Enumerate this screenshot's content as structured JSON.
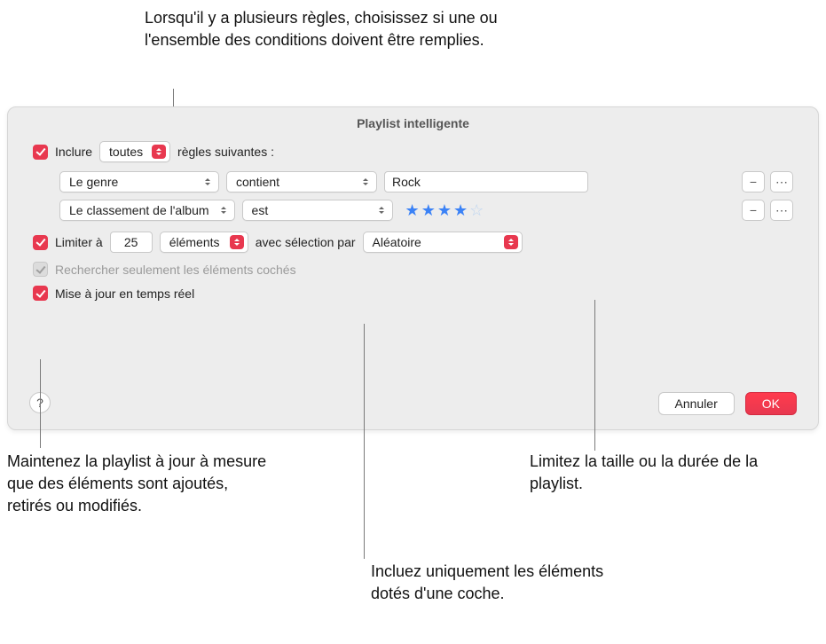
{
  "callouts": {
    "top": "Lorsqu'il y a plusieurs règles, choisissez si une ou l'ensemble des conditions doivent être remplies.",
    "bottom_left": "Maintenez la playlist à jour à mesure que des éléments sont ajoutés, retirés ou modifiés.",
    "bottom_right": "Limitez la taille ou la durée de la playlist.",
    "bottom_mid": "Incluez uniquement les éléments dotés d'une coche."
  },
  "dialog": {
    "title": "Playlist intelligente",
    "include": {
      "label_before": "Inclure",
      "mode": "toutes",
      "label_after": "règles suivantes :"
    },
    "rules": [
      {
        "field": "Le genre",
        "op": "contient",
        "value": "Rock",
        "type": "text"
      },
      {
        "field": "Le classement de l'album",
        "op": "est",
        "stars": 4,
        "type": "stars"
      }
    ],
    "limit": {
      "label": "Limiter à",
      "count": "25",
      "unit": "éléments",
      "by_label": "avec sélection par",
      "by_value": "Aléatoire"
    },
    "only_checked": "Rechercher seulement les éléments cochés",
    "live_update": "Mise à jour en temps réel",
    "buttons": {
      "cancel": "Annuler",
      "ok": "OK"
    },
    "help": "?"
  }
}
